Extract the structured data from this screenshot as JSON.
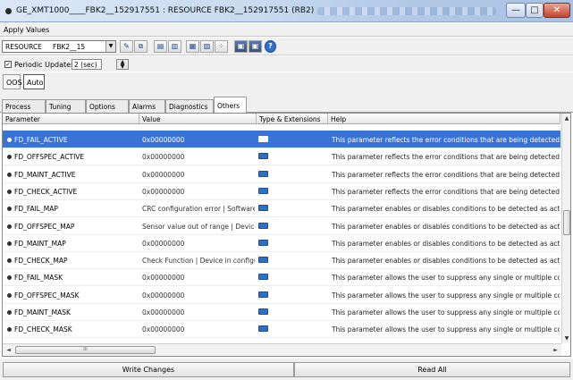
{
  "window": {
    "title": "GE_XMT1000____FBK2__152917551 : RESOURCE     FBK2__152917551 (RB2)",
    "minimize": "—",
    "maximize": "□",
    "close": "✕"
  },
  "menu": {
    "apply_values": "Apply Values"
  },
  "toolbar": {
    "block_type": "RESOURCE",
    "block_name": "FBK2__15",
    "dropdown_arrow": "▼",
    "icons": [
      "edit-icon",
      "compare-icon",
      "save-icon",
      "load-icon",
      "print-icon",
      "export-icon",
      "settings-icon",
      "view-icon",
      "view-alt-icon",
      "help-icon"
    ]
  },
  "periodic": {
    "checked": true,
    "check_mark": "✓",
    "label": "Periodic Updates",
    "interval": "2 (sec)"
  },
  "mode": {
    "oos": "OOS",
    "auto": "Auto"
  },
  "tabs": [
    "Process",
    "Tuning",
    "Options",
    "Alarms",
    "Diagnostics",
    "Others"
  ],
  "active_tab": "Others",
  "table": {
    "columns": [
      "Parameter",
      "Value",
      "Type & Extensions",
      "Help"
    ],
    "rows": [
      {
        "param": "FD_FAIL_ACTIVE",
        "value": "0x00000000",
        "help": "This parameter reflects the error conditions that are being detected as acti"
      },
      {
        "param": "FD_OFFSPEC_ACTIVE",
        "value": "0x00000000",
        "help": "This parameter reflects the error conditions that are being detected as acti"
      },
      {
        "param": "FD_MAINT_ACTIVE",
        "value": "0x00000000",
        "help": "This parameter reflects the error conditions that are being detected as acti"
      },
      {
        "param": "FD_CHECK_ACTIVE",
        "value": "0x00000000",
        "help": "This parameter reflects the error conditions that are being detected as acti"
      },
      {
        "param": "FD_FAIL_MAP",
        "value": "CRC configuration error | Software fai",
        "help": "This parameter enables or disables conditions to be detected as active for"
      },
      {
        "param": "FD_OFFSPEC_MAP",
        "value": "Sensor value out of range | Device n",
        "help": "This parameter enables or disables conditions to be detected as active for"
      },
      {
        "param": "FD_MAINT_MAP",
        "value": "0x00000000",
        "help": "This parameter enables or disables conditions to be detected as active for"
      },
      {
        "param": "FD_CHECK_MAP",
        "value": "Check Function | Device in configura",
        "help": "This parameter enables or disables conditions to be detected as active for"
      },
      {
        "param": "FD_FAIL_MASK",
        "value": "0x00000000",
        "help": "This parameter allows the user to suppress any single or multiple condition"
      },
      {
        "param": "FD_OFFSPEC_MASK",
        "value": "0x00000000",
        "help": "This parameter allows the user to suppress any single or multiple condition"
      },
      {
        "param": "FD_MAINT_MASK",
        "value": "0x00000000",
        "help": "This parameter allows the user to suppress any single or multiple condition"
      },
      {
        "param": "FD_CHECK_MASK",
        "value": "0x00000000",
        "help": "This parameter allows the user to suppress any single or multiple condition"
      }
    ],
    "selected_row": 0
  },
  "scroll": {
    "up": "▲",
    "down": "▼",
    "left": "◄",
    "right": "►",
    "grip": "III"
  },
  "buttons": {
    "write_changes": "Write Changes",
    "read_all": "Read All"
  },
  "colors": {
    "selection": "#3a73d8",
    "type_icon": "#2f6fc6",
    "close_button": "#c5452b"
  }
}
